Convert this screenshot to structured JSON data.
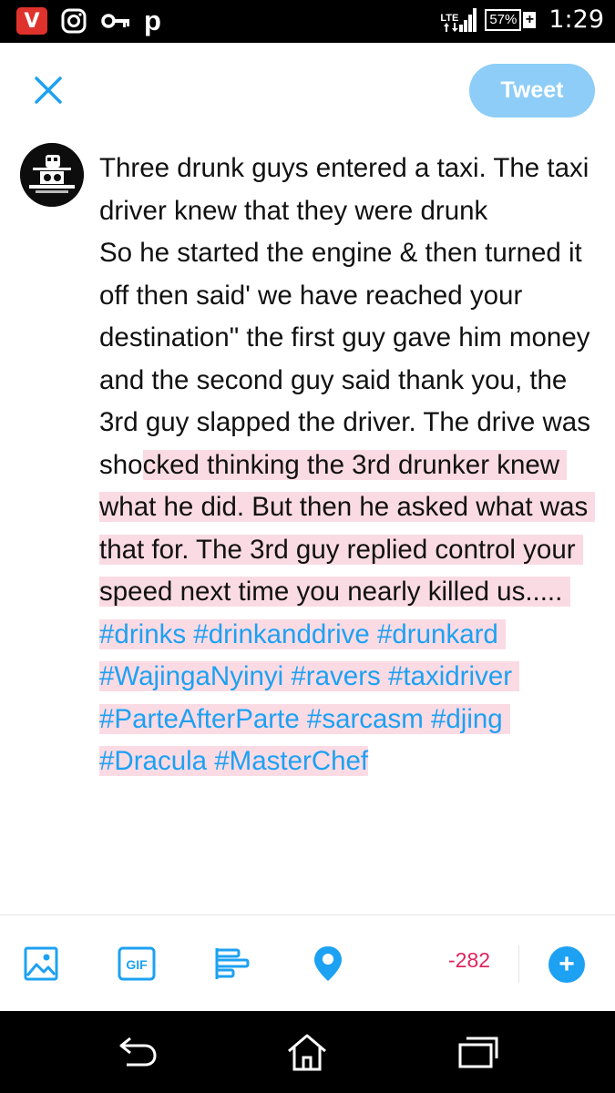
{
  "status_bar": {
    "app_icon_letter": "V",
    "parking_letter": "p",
    "network": "LTE",
    "battery": "57%",
    "battery_charging": "+",
    "time": "1:29"
  },
  "header": {
    "tweet_label": "Tweet"
  },
  "compose": {
    "text_plain": "Three drunk guys entered a taxi. The taxi driver knew that they were drunk\nSo he started the engine & then turned it off then said' we have reached your destination\" the first guy gave him money and the second guy said thank you, the 3rd guy slapped the driver. The drive was sho",
    "text_over": "cked thinking the 3rd drunker knew what he did. But then he asked what was that for. The 3rd guy replied control your speed next time you nearly killed us..... ",
    "hashtags": "#drinks #drinkanddrive #drunkard #WajingaNyinyi #ravers #taxidriver #ParteAfterParte #sarcasm #djing #Dracula #MasterChef"
  },
  "toolbar": {
    "counter": "-282",
    "add_label": "+"
  },
  "colors": {
    "accent": "#1da1f2",
    "tweet_button_disabled": "#8dcdf7",
    "overflow_highlight": "#fadbe4",
    "counter_negative": "#e0245e"
  },
  "icons": {
    "status": [
      "vivaldi-icon",
      "instagram-icon",
      "key-icon",
      "parking-icon",
      "signal-icon",
      "battery-icon"
    ],
    "toolbar": [
      "image-icon",
      "gif-icon",
      "poll-icon",
      "location-icon",
      "add-icon"
    ],
    "nav": [
      "back-icon",
      "home-icon",
      "recents-icon"
    ]
  }
}
